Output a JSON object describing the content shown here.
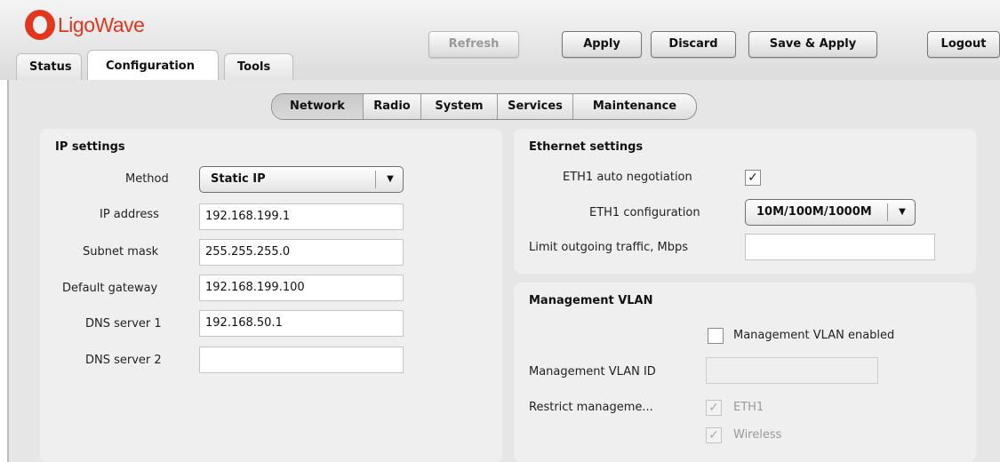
{
  "brand": {
    "name": "LigoWave",
    "color": "#e3361f"
  },
  "main_tabs": [
    {
      "label": "Status",
      "active": false
    },
    {
      "label": "Configuration",
      "active": true
    },
    {
      "label": "Tools",
      "active": false
    }
  ],
  "toolbar": {
    "refresh_label": "Refresh",
    "apply_label": "Apply",
    "discard_label": "Discard",
    "save_apply_label": "Save & Apply",
    "logout_label": "Logout"
  },
  "sub_tabs": [
    {
      "label": "Network",
      "active": true
    },
    {
      "label": "Radio",
      "active": false
    },
    {
      "label": "System",
      "active": false
    },
    {
      "label": "Services",
      "active": false
    },
    {
      "label": "Maintenance",
      "active": false
    }
  ],
  "ip_settings": {
    "title": "IP settings",
    "method_label": "Method",
    "method_value": "Static IP",
    "ip_label": "IP address",
    "ip_value": "192.168.199.1",
    "subnet_label": "Subnet mask",
    "subnet_value": "255.255.255.0",
    "gateway_label": "Default gateway",
    "gateway_value": "192.168.199.100",
    "dns1_label": "DNS server 1",
    "dns1_value": "192.168.50.1",
    "dns2_label": "DNS server 2",
    "dns2_value": ""
  },
  "ethernet_settings": {
    "title": "Ethernet settings",
    "autoneg_label": "ETH1 auto negotiation",
    "autoneg_checked": true,
    "config_label": "ETH1 configuration",
    "config_value": "10M/100M/1000M",
    "limit_label": "Limit outgoing traffic, Mbps",
    "limit_value": ""
  },
  "management_vlan": {
    "title": "Management VLAN",
    "enabled_label": "Management VLAN enabled",
    "enabled_checked": false,
    "vlan_id_label": "Management VLAN ID",
    "vlan_id_value": "",
    "restrict_label": "Restrict manageme...",
    "eth1_label": "ETH1",
    "eth1_checked": true,
    "wireless_label": "Wireless",
    "wireless_checked": true
  },
  "icons": {
    "check": "check-icon",
    "dropdown": "chevron-down-icon"
  }
}
